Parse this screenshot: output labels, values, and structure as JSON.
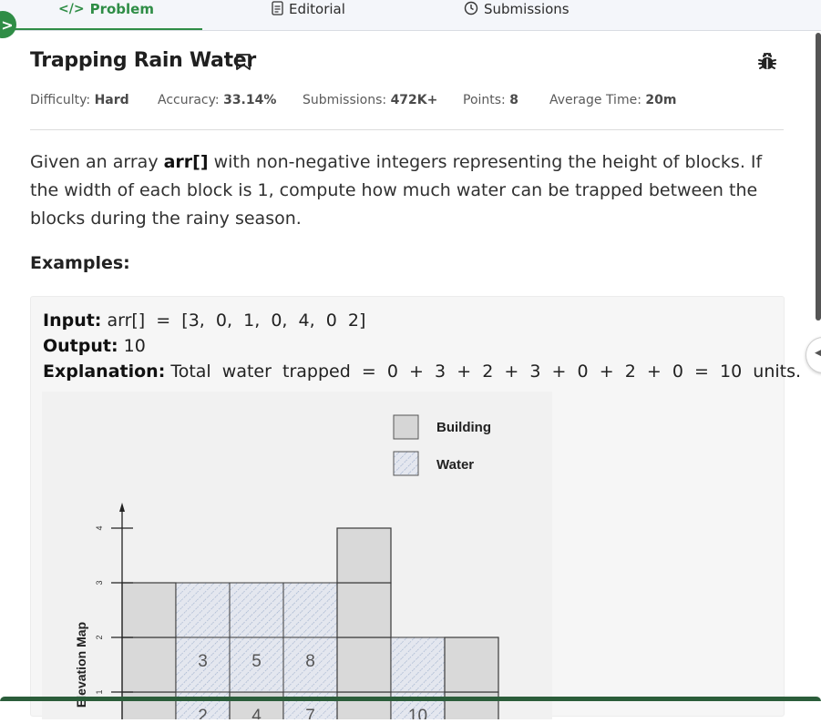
{
  "tabs": [
    {
      "label": "Problem",
      "icon": "code-icon",
      "active": true
    },
    {
      "label": "Editorial",
      "icon": "document-icon",
      "active": false
    },
    {
      "label": "Submissions",
      "icon": "clock-icon",
      "active": false
    }
  ],
  "problem": {
    "title": "Trapping Rain Water",
    "meta": {
      "difficulty_label": "Difficulty:",
      "difficulty_value": "Hard",
      "accuracy_label": "Accuracy:",
      "accuracy_value": "33.14%",
      "submissions_label": "Submissions:",
      "submissions_value": "472K+",
      "points_label": "Points:",
      "points_value": "8",
      "avg_time_label": "Average Time:",
      "avg_time_value": "20m"
    },
    "description": {
      "part1": "Given an array ",
      "bold": "arr[]",
      "part2": " with non-negative integers representing the height of blocks. If the width of each block is 1, compute how much water can be trapped between the blocks during the rainy season."
    },
    "examples_heading": "Examples:",
    "example1": {
      "input_label": "Input:",
      "input_value": " arr[]  =  [3,  0,  1,  0,  4,  0  2]",
      "output_label": "Output:",
      "output_value": " 10",
      "explanation_label": "Explanation:",
      "explanation_value": " Total  water  trapped  =  0  +  3  +  2  +  3  +  0  +  2  +  0  =  10  units."
    }
  },
  "figure": {
    "legend": {
      "building": "Building",
      "water": "Water"
    },
    "ylabel": "Elevation Map",
    "yticks": [
      "1",
      "2",
      "3",
      "4"
    ],
    "heights": [
      3,
      0,
      1,
      0,
      4,
      0,
      2
    ],
    "water_numbers": [
      "2",
      "3",
      "4",
      "5",
      "7",
      "8",
      "10"
    ]
  },
  "colors": {
    "accent": "#2f8d46",
    "building": "#d9d9d9",
    "water": "#e3e6ee"
  }
}
